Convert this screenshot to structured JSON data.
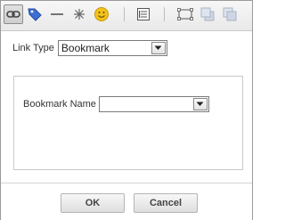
{
  "toolbar": {
    "icons": [
      "link-icon",
      "tag-icon",
      "horizontal-rule-icon",
      "special-character-icon",
      "emoticon-icon",
      "layout-icon",
      "frame-icon",
      "bring-forward-icon",
      "send-backward-icon"
    ]
  },
  "link_type": {
    "label": "Link Type",
    "selected": "Bookmark"
  },
  "bookmark": {
    "label": "Bookmark Name",
    "selected": ""
  },
  "buttons": {
    "ok": "OK",
    "cancel": "Cancel"
  },
  "colors": {
    "tag": "#3b6fd4",
    "emoticon": "#f2c21b"
  }
}
